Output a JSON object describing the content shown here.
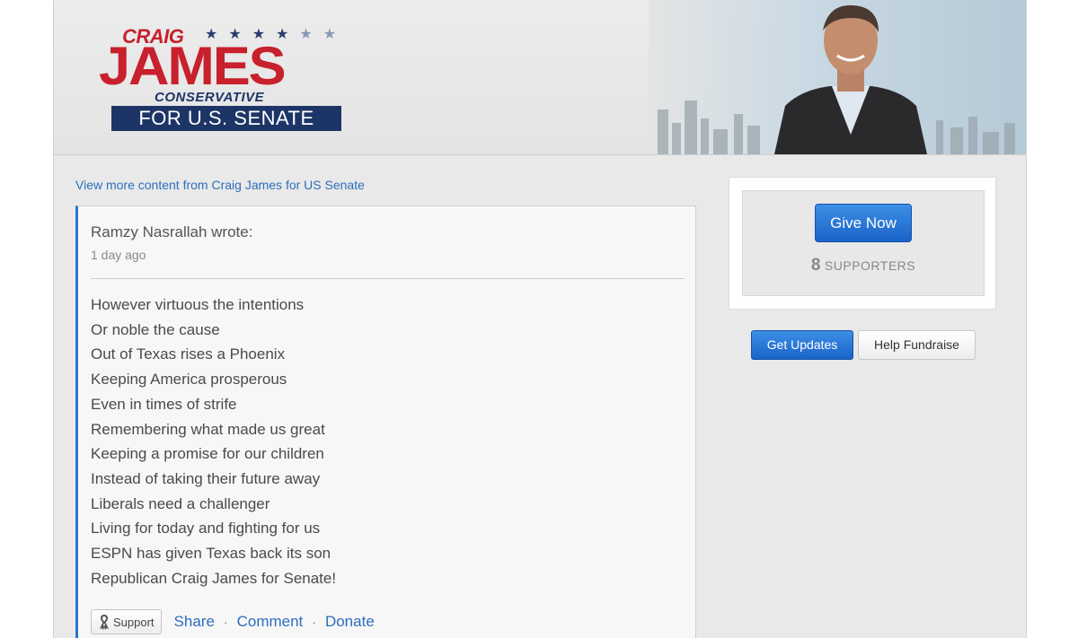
{
  "banner": {
    "logo": {
      "first_name": "CRAIG",
      "last_name": "JAMES",
      "tagline": "CONSERVATIVE",
      "office": "FOR U.S. SENATE"
    }
  },
  "view_more_link": "View more content from Craig James for US Senate",
  "post": {
    "author_line": "Ramzy Nasrallah wrote:",
    "timestamp": "1 day ago",
    "lines": [
      "However virtuous the intentions",
      "Or noble the cause",
      "Out of Texas rises a Phoenix",
      "Keeping America prosperous",
      "Even in times of strife",
      "Remembering what made us great",
      "Keeping a promise for our children",
      "Instead of taking their future away",
      "Liberals need a challenger",
      "Living for today and fighting for us",
      "ESPN has given Texas back its son",
      "Republican Craig James for Senate!"
    ],
    "actions": {
      "support": "Support",
      "share": "Share",
      "comment": "Comment",
      "donate": "Donate",
      "separator": "·"
    }
  },
  "sidebar": {
    "give_now": "Give Now",
    "supporter_count": "8",
    "supporter_label": "SUPPORTERS",
    "get_updates": "Get Updates",
    "help_fundraise": "Help Fundraise"
  },
  "colors": {
    "accent_blue": "#2d74c8",
    "logo_red": "#c8202c",
    "logo_navy": "#1d3566"
  }
}
